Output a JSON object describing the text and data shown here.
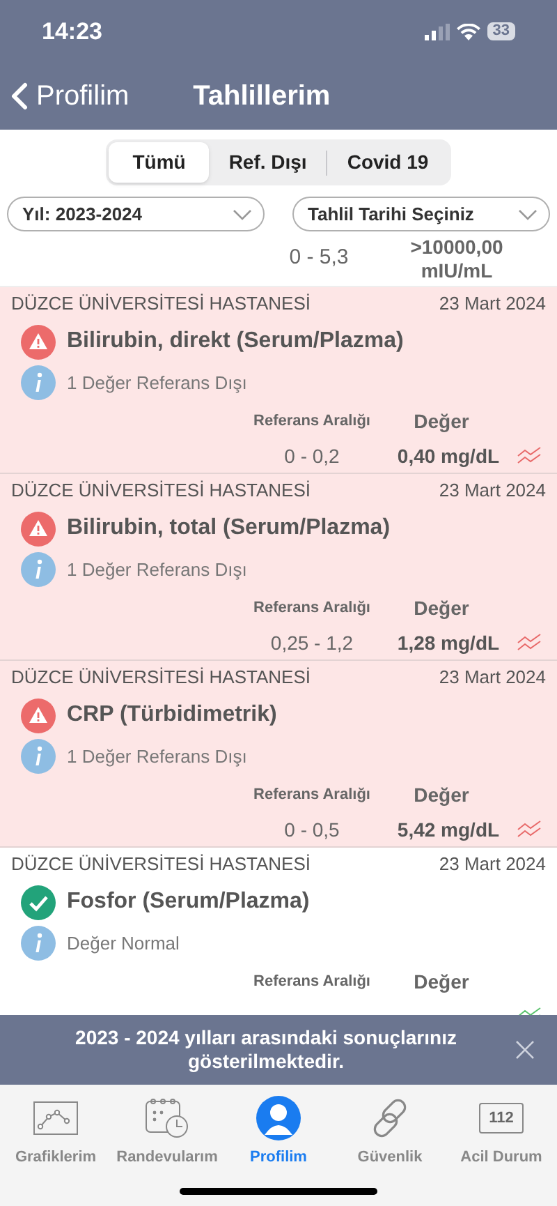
{
  "status_bar": {
    "time": "14:23",
    "battery": "33"
  },
  "nav": {
    "back_label": "Profilim",
    "title": "Tahlillerim"
  },
  "segments": [
    {
      "label": "Tümü",
      "selected": true
    },
    {
      "label": "Ref. Dışı",
      "selected": false
    },
    {
      "label": "Covid 19",
      "selected": false
    }
  ],
  "filters": [
    {
      "value": "Yıl: 2023-2024"
    },
    {
      "value": "Tahlil Tarihi Seçiniz"
    }
  ],
  "partial_row": {
    "reference": "0 - 5,3",
    "value": ">10000,00 mIU/mL"
  },
  "results": [
    {
      "hospital": "DÜZCE ÜNİVERSİTESİ HASTANESİ",
      "date": "23 Mart 2024",
      "test": "Bilirubin, direkt (Serum/Plazma)",
      "out_of_range": true,
      "note": "1 Değer Referans Dışı",
      "reference_header": "Referans Aralığı",
      "value_header": "Değer",
      "reference": "0 - 0,2",
      "value": "0,40 mg/dL"
    },
    {
      "hospital": "DÜZCE ÜNİVERSİTESİ HASTANESİ",
      "date": "23 Mart 2024",
      "test": "Bilirubin, total (Serum/Plazma)",
      "out_of_range": true,
      "note": "1 Değer Referans Dışı",
      "reference_header": "Referans Aralığı",
      "value_header": "Değer",
      "reference": "0,25 - 1,2",
      "value": "1,28 mg/dL"
    },
    {
      "hospital": "DÜZCE ÜNİVERSİTESİ HASTANESİ",
      "date": "23 Mart 2024",
      "test": "CRP (Türbidimetrik)",
      "out_of_range": true,
      "note": "1 Değer Referans Dışı",
      "reference_header": "Referans Aralığı",
      "value_header": "Değer",
      "reference": "0 - 0,5",
      "value": "5,42 mg/dL"
    },
    {
      "hospital": "DÜZCE ÜNİVERSİTESİ HASTANESİ",
      "date": "23 Mart 2024",
      "test": "Fosfor (Serum/Plazma)",
      "out_of_range": false,
      "note": "Değer Normal",
      "reference_header": "Referans Aralığı",
      "value_header": "Değer"
    }
  ],
  "toast": {
    "message": "2023 - 2024 yılları arasındaki sonuçlarınız gösterilmektedir."
  },
  "tab_bar": [
    {
      "kind": "chart",
      "label": "Grafiklerim",
      "selected": false
    },
    {
      "kind": "calendar",
      "label": "Randevularım",
      "selected": false
    },
    {
      "kind": "profile",
      "label": "Profilim",
      "selected": true
    },
    {
      "kind": "link",
      "label": "Güvenlik",
      "selected": false
    },
    {
      "kind": "emergency",
      "label": "Acil Durum",
      "badge": "112",
      "selected": false
    }
  ]
}
